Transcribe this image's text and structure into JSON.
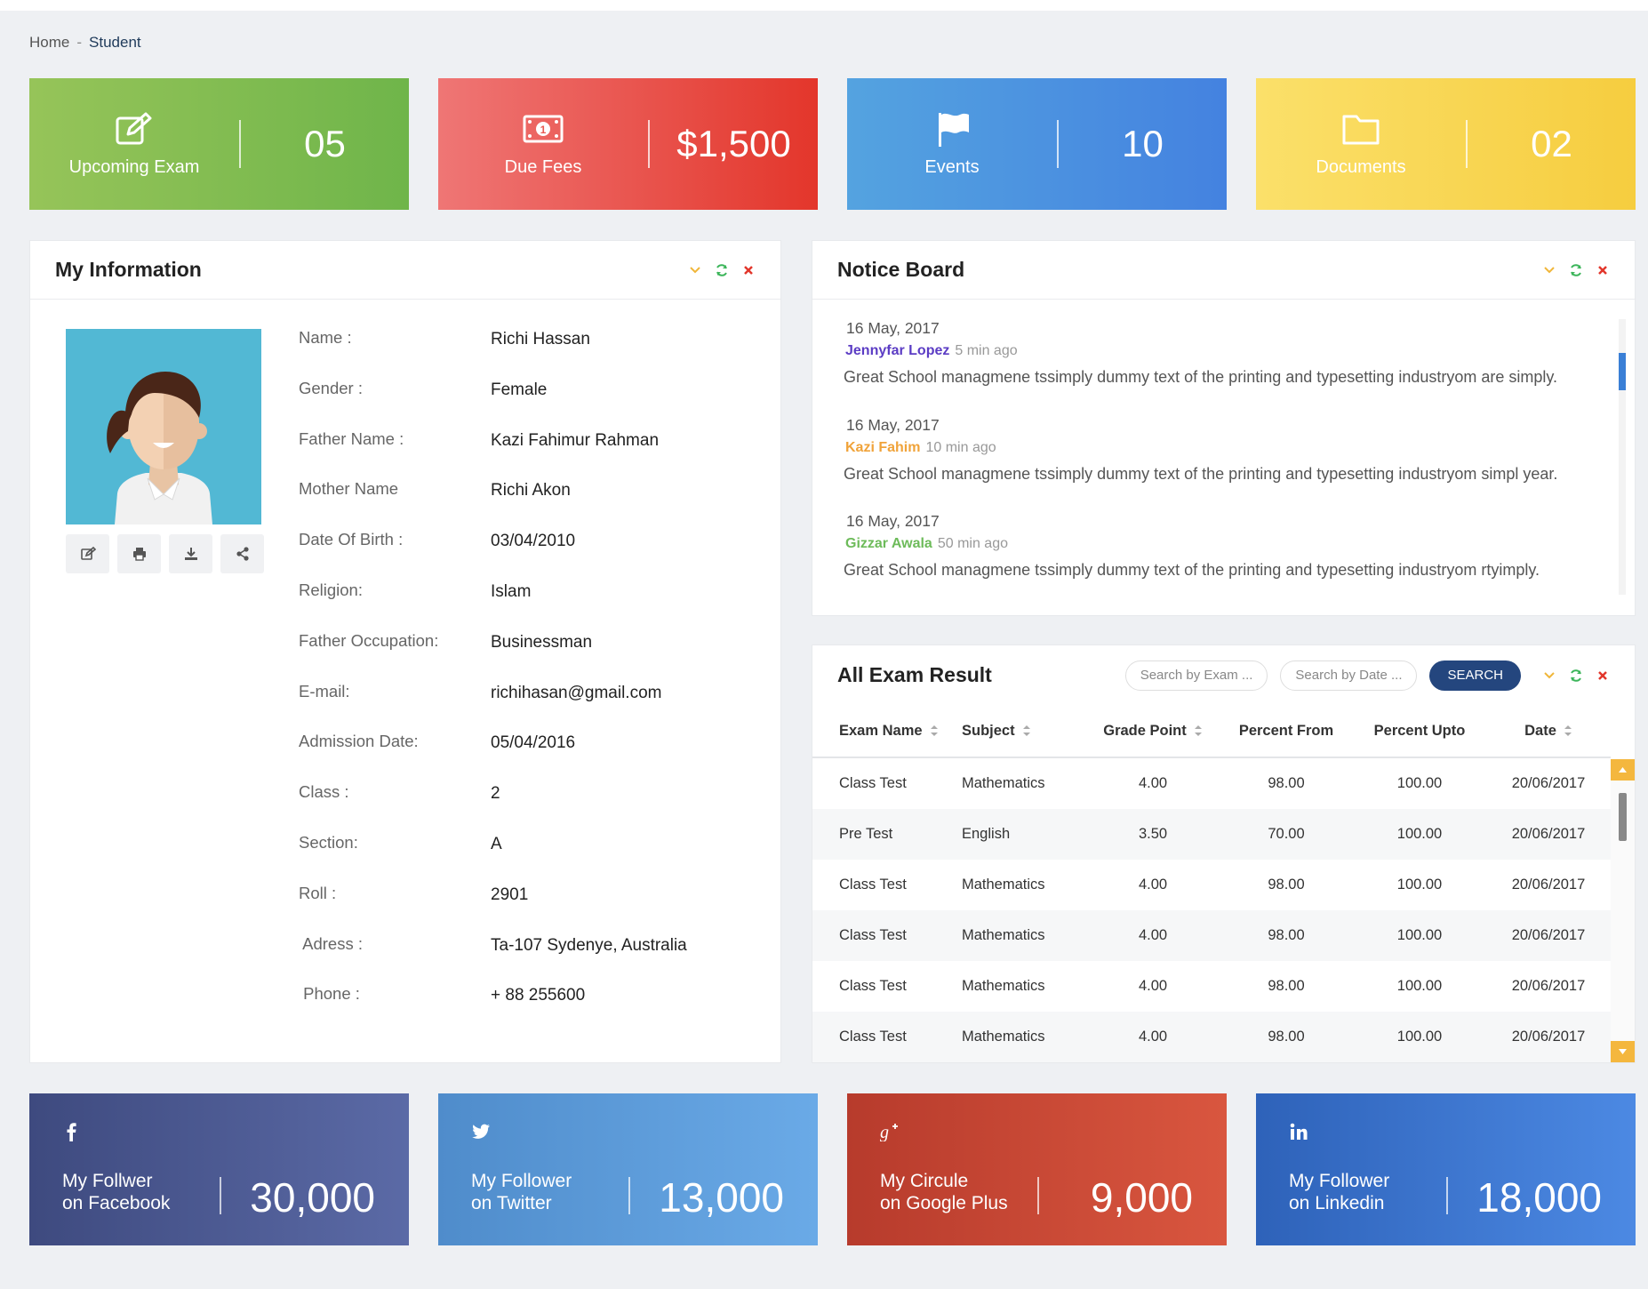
{
  "breadcrumb": {
    "home": "Home",
    "separator": "-",
    "current": "Student"
  },
  "stats": [
    {
      "label": "Upcoming Exam",
      "value": "05",
      "icon": "edit-icon"
    },
    {
      "label": "Due Fees",
      "value": "$1,500",
      "icon": "money-icon"
    },
    {
      "label": "Events",
      "value": "10",
      "icon": "flag-icon"
    },
    {
      "label": "Documents",
      "value": "02",
      "icon": "folder-icon"
    }
  ],
  "my_info": {
    "title": "My Information",
    "fields": [
      {
        "label": "Name :",
        "value": "Richi Hassan"
      },
      {
        "label": "Gender :",
        "value": "Female"
      },
      {
        "label": "Father Name :",
        "value": "Kazi Fahimur Rahman"
      },
      {
        "label": "Mother Name",
        "value": "Richi Akon"
      },
      {
        "label": "Date Of Birth :",
        "value": "03/04/2010"
      },
      {
        "label": "Religion:",
        "value": "Islam"
      },
      {
        "label": "Father Occupation:",
        "value": "Businessman"
      },
      {
        "label": "E-mail:",
        "value": "richihasan@gmail.com"
      },
      {
        "label": "Admission Date:",
        "value": "05/04/2016"
      },
      {
        "label": "Class :",
        "value": "2"
      },
      {
        "label": "Section:",
        "value": "A"
      },
      {
        "label": "Roll :",
        "value": "2901"
      },
      {
        "label": " Adress :",
        "value": "Ta-107 Sydenye, Australia"
      },
      {
        "label": " Phone :",
        "value": "+ 88 255600"
      }
    ]
  },
  "notice_board": {
    "title": "Notice Board",
    "items": [
      {
        "date": "16 May, 2017",
        "author": "Jennyfar Lopez",
        "author_color": "#5b3cc4",
        "ago": "5 min ago",
        "text": "Great School managmene tssimply dummy text of the printing and typesetting industryom are simply."
      },
      {
        "date": "16 May, 2017",
        "author": "Kazi Fahim",
        "author_color": "#f0a33a",
        "ago": "10 min ago",
        "text": "Great School managmene tssimply dummy text of the printing and typesetting industryom simpl year."
      },
      {
        "date": "16 May, 2017",
        "author": "Gizzar Awala",
        "author_color": "#6dbb5a",
        "ago": "50 min ago",
        "text": "Great School managmene tssimply dummy text of the printing and typesetting industryom rtyimply."
      }
    ]
  },
  "exam_result": {
    "title": "All Exam Result",
    "search_exam_placeholder": "Search by Exam ...",
    "search_date_placeholder": "Search by Date ...",
    "search_button": "SEARCH",
    "columns": [
      "Exam Name",
      "Subject",
      "Grade Point",
      "Percent From",
      "Percent Upto",
      "Date"
    ],
    "rows": [
      [
        "Class Test",
        "Mathematics",
        "4.00",
        "98.00",
        "100.00",
        "20/06/2017"
      ],
      [
        "Pre Test",
        "English",
        "3.50",
        "70.00",
        "100.00",
        "20/06/2017"
      ],
      [
        "Class Test",
        "Mathematics",
        "4.00",
        "98.00",
        "100.00",
        "20/06/2017"
      ],
      [
        "Class Test",
        "Mathematics",
        "4.00",
        "98.00",
        "100.00",
        "20/06/2017"
      ],
      [
        "Class Test",
        "Mathematics",
        "4.00",
        "98.00",
        "100.00",
        "20/06/2017"
      ],
      [
        "Class Test",
        "Mathematics",
        "4.00",
        "98.00",
        "100.00",
        "20/06/2017"
      ]
    ]
  },
  "social": [
    {
      "line1": "My Follwer",
      "line2": "on Facebook",
      "value": "30,000",
      "icon": "facebook-icon"
    },
    {
      "line1": "My Follower",
      "line2": "on Twitter",
      "value": "13,000",
      "icon": "twitter-icon"
    },
    {
      "line1": "My Circule",
      "line2": "on Google Plus",
      "value": "9,000",
      "icon": "google-plus-icon"
    },
    {
      "line1": "My Follower",
      "line2": "on Linkedin",
      "value": "18,000",
      "icon": "linkedin-icon"
    }
  ],
  "colors": {
    "collapse": "#f0b63a",
    "refresh": "#3cb55a",
    "close": "#e2362b",
    "search_button": "#24467e"
  }
}
